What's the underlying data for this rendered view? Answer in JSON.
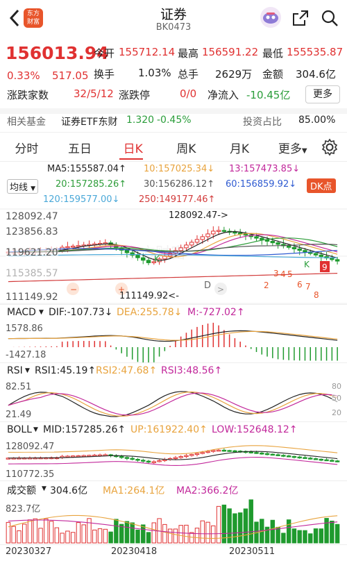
{
  "header": {
    "back_icon": "back-icon",
    "logo_text": "东方财富",
    "title": "证券",
    "code": "BK0473",
    "avatar_icon": "avatar-icon",
    "share_icon": "share-icon",
    "search_icon": "search-icon"
  },
  "quote": {
    "price": "156013.94",
    "change_pct": "0.33%",
    "change_amt": "517.05",
    "open_label": "今开",
    "open": "155712.14",
    "high_label": "最高",
    "high": "156591.22",
    "low_label": "最低",
    "low": "155535.87",
    "turnover_label": "换手",
    "turnover": "1.03%",
    "volume_label": "总手",
    "volume": "2629万",
    "amount_label": "金额",
    "amount": "304.6亿",
    "counts_label": "涨跌家数",
    "counts": "32/5/12",
    "limit_label": "涨跌停",
    "limit": "0/0",
    "inflow_label": "净流入",
    "inflow": "-10.45亿",
    "more_label": "更多"
  },
  "fund": {
    "label": "相关基金",
    "name": "证券ETF东财",
    "price": "1.320",
    "change": "-0.45%",
    "ratio_label": "投资占比",
    "ratio": "85.00%"
  },
  "tabs": [
    "分时",
    "五日",
    "日K",
    "周K",
    "月K",
    "更多"
  ],
  "ma_legend": {
    "ma5": "MA5:155587.04↑",
    "ma10": "10:157025.34↓",
    "ma13": "13:157473.85↓",
    "ma20": "20:157285.26↑",
    "ma30": "30:156286.12↑",
    "ma60": "60:156859.92↓",
    "ma120": "120:159577.00↓",
    "ma250": "250:149177.46↑",
    "selector": "均线",
    "dk_button": "DK点"
  },
  "kline": {
    "ylabels": [
      "128092.47",
      "123856.83",
      "119621.20",
      "115385.57",
      "111149.92"
    ],
    "max_label": "128092.47->",
    "min_label": "111149.92<-",
    "watermark": "东方财富"
  },
  "macd": {
    "name": "MACD",
    "dif": "DIF:-107.73↓",
    "dea": "DEA:255.78↓",
    "m": "M:-727.02↑",
    "top": "1578.86",
    "bottom": "-1427.18"
  },
  "rsi": {
    "name": "RSI",
    "rsi1": "RSI1:45.19↑",
    "rsi2": "RSI2:47.68↑",
    "rsi3": "RSI3:48.56↑",
    "top": "82.51",
    "bottom": "21.49",
    "r80": "80",
    "r50": "50",
    "r20": "20"
  },
  "boll": {
    "name": "BOLL",
    "mid": "MID:157285.26↑",
    "up": "UP:161922.40↑",
    "low": "LOW:152648.12↑",
    "top": "128092.47",
    "bottom": "110772.35"
  },
  "vol": {
    "name": "成交额",
    "value": "304.6亿",
    "ma1": "MA1:264.1亿",
    "ma2": "MA2:366.2亿",
    "top": "823.7亿"
  },
  "dates": [
    "20230327",
    "20230418",
    "20230511"
  ],
  "colors": {
    "up": "#e03131",
    "down": "#1f9a2e",
    "ma5": "#222222",
    "ma10": "#e8a33d",
    "ma13": "#c2289b",
    "ma20": "#2e9d3a",
    "ma30": "#555555",
    "ma60": "#2f5bd1",
    "ma120": "#4aa8d8",
    "ma250": "#d23b3b"
  }
}
